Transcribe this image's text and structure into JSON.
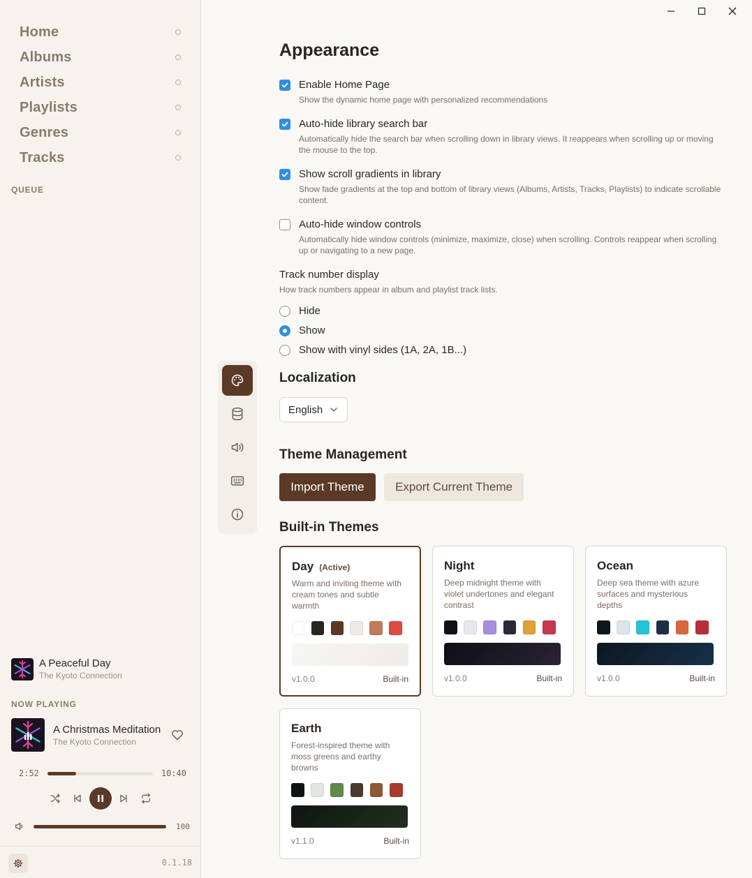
{
  "sidebar": {
    "nav": [
      {
        "label": "Home"
      },
      {
        "label": "Albums"
      },
      {
        "label": "Artists"
      },
      {
        "label": "Playlists"
      },
      {
        "label": "Genres"
      },
      {
        "label": "Tracks"
      }
    ],
    "queue_label": "QUEUE",
    "next_track": {
      "title": "A Peaceful Day",
      "artist": "The Kyoto Connection"
    },
    "now_playing_label": "NOW PLAYING",
    "now_playing": {
      "title": "A Christmas Meditation",
      "artist": "The Kyoto Connection"
    },
    "progress": {
      "elapsed": "2:52",
      "total": "10:40",
      "fraction": 0.27
    },
    "volume": {
      "value": "100",
      "fraction": 1.0
    },
    "version": "0.1.18"
  },
  "settings": {
    "rail": [
      "palette-icon",
      "database-icon",
      "speaker-icon",
      "keyboard-icon",
      "info-icon"
    ],
    "appearance": {
      "title": "Appearance",
      "options": [
        {
          "title": "Enable Home Page",
          "desc": "Show the dynamic home page with personalized recommendations",
          "checked": true
        },
        {
          "title": "Auto-hide library search bar",
          "desc": "Automatically hide the search bar when scrolling down in library views. It reappears when scrolling up or moving the mouse to the top.",
          "checked": true
        },
        {
          "title": "Show scroll gradients in library",
          "desc": "Show fade gradients at the top and bottom of library views (Albums, Artists, Tracks, Playlists) to indicate scrollable content.",
          "checked": true
        },
        {
          "title": "Auto-hide window controls",
          "desc": "Automatically hide window controls (minimize, maximize, close) when scrolling. Controls reappear when scrolling up or navigating to a new page.",
          "checked": false
        }
      ],
      "track_number": {
        "title": "Track number display",
        "desc": "How track numbers appear in album and playlist track lists.",
        "options": [
          "Hide",
          "Show",
          "Show with vinyl sides (1A, 2A, 1B...)"
        ],
        "selected": 1
      }
    },
    "localization": {
      "title": "Localization",
      "language": "English"
    },
    "theme_management": {
      "title": "Theme Management",
      "import_label": "Import Theme",
      "export_label": "Export Current Theme"
    },
    "builtin": {
      "title": "Built-in Themes",
      "themes": [
        {
          "name": "Day",
          "active_label": "(Active)",
          "desc": "Warm and inviting theme with cream tones and subtle warmth",
          "colors": [
            "#ffffff",
            "#2b2520",
            "#5a3a26",
            "#efe9e4",
            "#c27a5a",
            "#df4a3e"
          ],
          "preview": [
            "#f8f6f3",
            "#efebe6"
          ],
          "version": "v1.0.0",
          "type": "Built-in"
        },
        {
          "name": "Night",
          "active_label": "",
          "desc": "Deep midnight theme with violet undertones and elegant contrast",
          "colors": [
            "#121018",
            "#e8e6ee",
            "#a78ee0",
            "#2c2a3a",
            "#e0a03a",
            "#c8364e"
          ],
          "preview": [
            "#0f0e16",
            "#2a2334"
          ],
          "version": "v1.0.0",
          "type": "Built-in"
        },
        {
          "name": "Ocean",
          "active_label": "",
          "desc": "Deep sea theme with azure surfaces and mysterious depths",
          "colors": [
            "#0e1620",
            "#d8e6ec",
            "#24c4d4",
            "#1e3048",
            "#d8683e",
            "#b82e3a"
          ],
          "preview": [
            "#0d1620",
            "#16324a"
          ],
          "version": "v1.0.0",
          "type": "Built-in"
        },
        {
          "name": "Earth",
          "active_label": "",
          "desc": "Forest-inspired theme with moss greens and earthy browns",
          "colors": [
            "#0e1410",
            "#e2e6e0",
            "#5e8a4a",
            "#4a3a2e",
            "#8e5a36",
            "#a83a2e"
          ],
          "preview": [
            "#0e160f",
            "#22301f"
          ],
          "version": "v1.1.0",
          "type": "Built-in"
        }
      ]
    }
  }
}
